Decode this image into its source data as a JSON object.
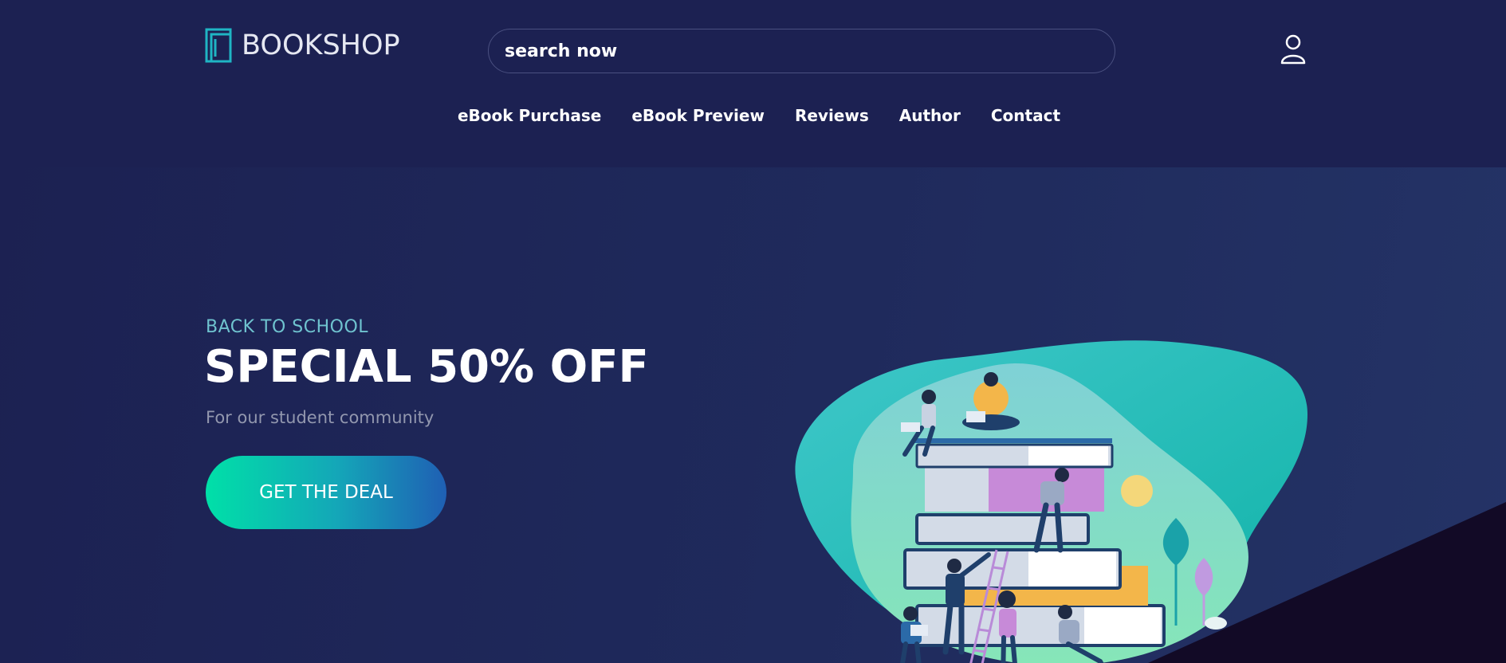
{
  "header": {
    "logo_text": "BOOKSHOP",
    "logo_icon": "book-icon",
    "search": {
      "placeholder": "search now",
      "value": ""
    },
    "user_icon": "user-icon",
    "nav": [
      {
        "label": "eBook Purchase"
      },
      {
        "label": "eBook Preview"
      },
      {
        "label": "Reviews"
      },
      {
        "label": "Author"
      },
      {
        "label": "Contact"
      }
    ]
  },
  "hero": {
    "eyebrow": "BACK TO SCHOOL",
    "headline": "SPECIAL 50% OFF",
    "subtitle": "For our student community",
    "cta_label": "GET THE DEAL",
    "illustration": "books-stack-students-illustration"
  },
  "colors": {
    "background": "#1c2152",
    "accent_teal": "#00e0a8",
    "accent_blue": "#1f5fb4",
    "eyebrow": "#6fc3cf",
    "logo_icon": "#1fb5c4"
  }
}
